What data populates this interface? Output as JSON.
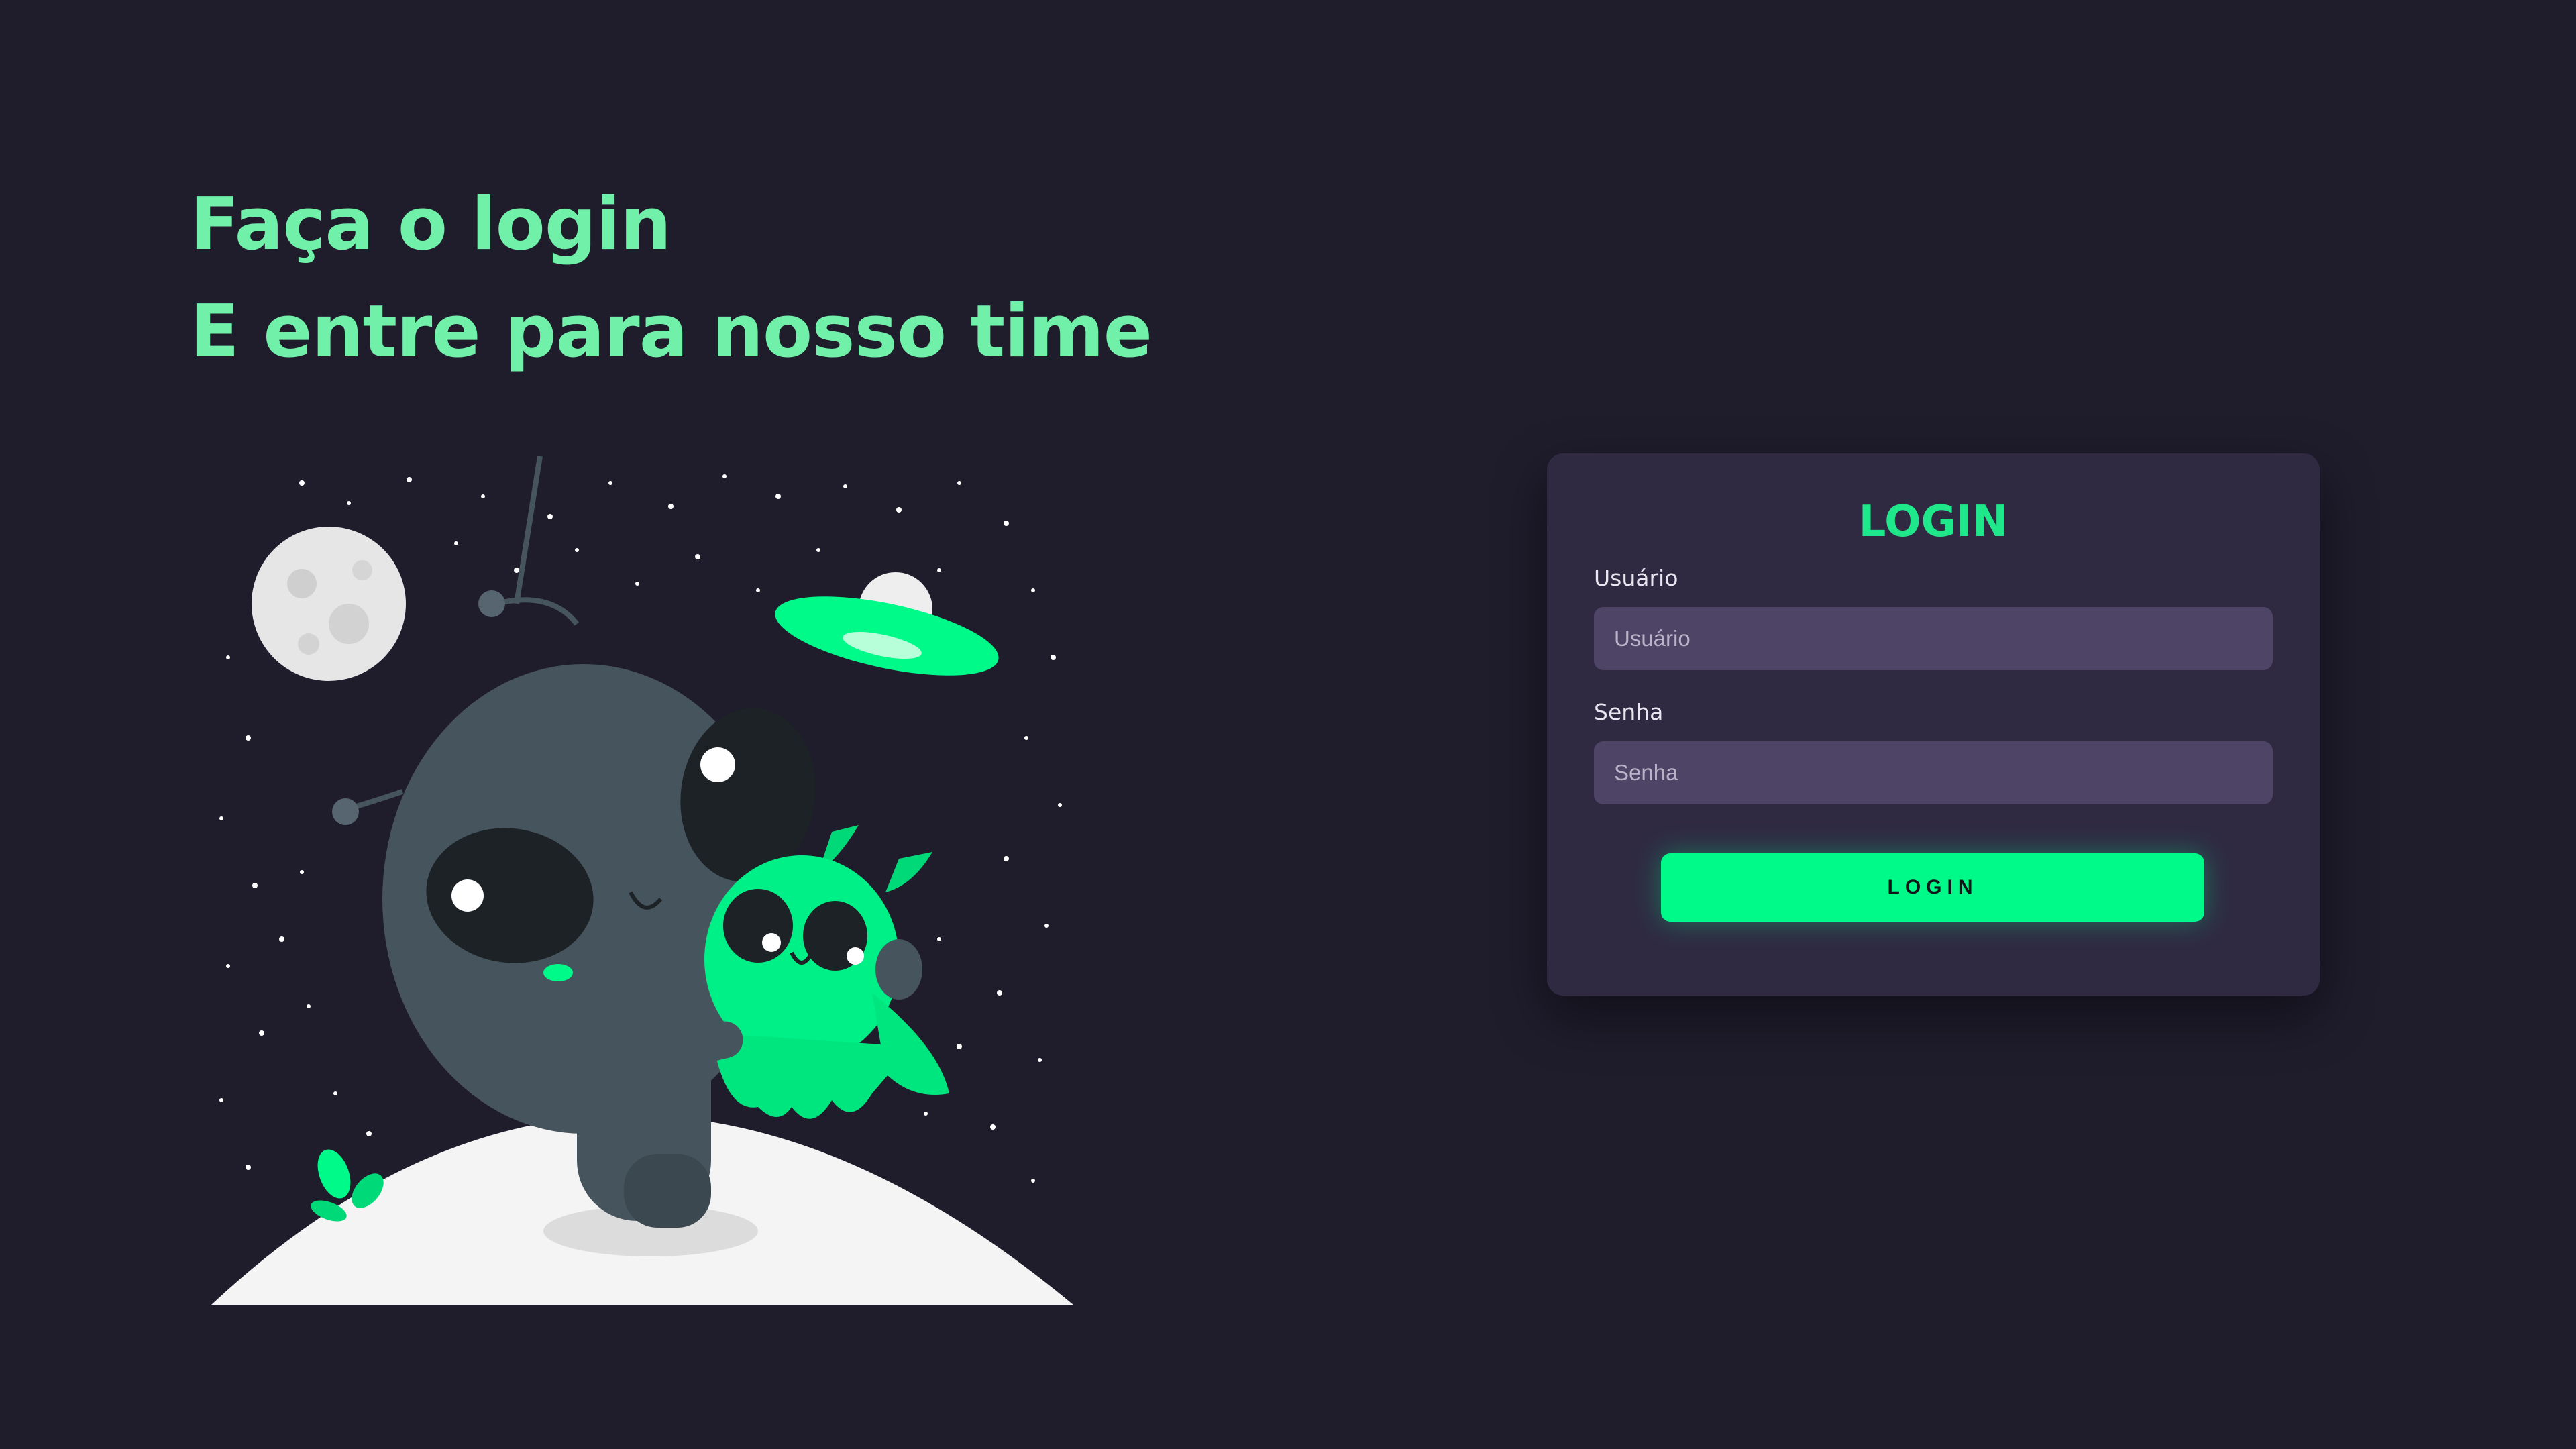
{
  "headline": {
    "line1": "Faça o login",
    "line2": "E entre para nosso time"
  },
  "illustration": {
    "icon": "alien-hugging-illustration"
  },
  "login_card": {
    "title": "LOGIN",
    "username": {
      "label": "Usuário",
      "placeholder": "Usuário",
      "value": ""
    },
    "password": {
      "label": "Senha",
      "placeholder": "Senha",
      "value": ""
    },
    "button_label": "LOGIN"
  },
  "colors": {
    "background": "#1f1c2c",
    "headline": "#70f0a8",
    "accent": "#00fa8a",
    "card": "#2f2a42",
    "input": "#4d4466"
  }
}
